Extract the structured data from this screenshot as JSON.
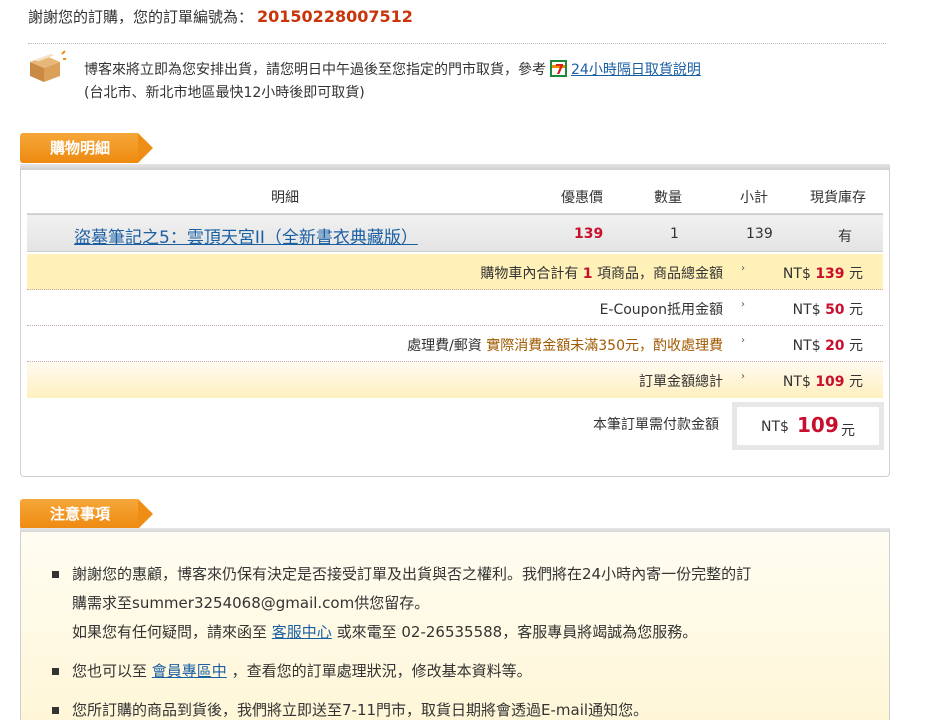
{
  "header": {
    "thanks": "謝謝您的訂購，您的訂單編號為：",
    "order_number": "20150228007512"
  },
  "shipping": {
    "line1": "博客來將立即為您安排出貨，請您明日中午過後至您指定的門市取貨，參考",
    "link": "24小時隔日取貨說明",
    "line2": "(台北市、新北市地區最快12小時後即可取貨)"
  },
  "section_detail": {
    "title": "購物明細"
  },
  "table": {
    "headers": [
      "明細",
      "優惠價",
      "數量",
      "小計",
      "現貨庫存"
    ],
    "item": {
      "name": "盜墓筆記之5：雲頂天宮II（全新書衣典藏版）",
      "price": "139",
      "qty": "1",
      "subtotal": "139",
      "stock": "有"
    }
  },
  "summary": {
    "cart_pre": "購物車內合計有",
    "cart_count": "1",
    "cart_post": "項商品，商品總金額",
    "cart_amount": "139",
    "coupon_label": "E-Coupon抵用金額",
    "coupon_amount": "50",
    "fee_label": "處理費/郵資",
    "fee_note": "實際消費金額未滿350元，酌收處理費",
    "fee_amount": "20",
    "total_label": "訂單金額總計",
    "total_amount": "109",
    "currency": "NT$",
    "unit": "元",
    "arrow": "›",
    "pay_label": "本筆訂單需付款金額",
    "pay_amount": "109"
  },
  "section_notes": {
    "title": "注意事項"
  },
  "notes": {
    "n1_line1": "謝謝您的惠顧，博客來仍保有決定是否接受訂單及出貨與否之權利。我們將在24小時內寄一份完整的訂",
    "n1_line2": "購需求至summer3254068@gmail.com供您留存。",
    "n1_line3_pre": "如果您有任何疑問，請來函至",
    "n1_link": "客服中心",
    "n1_line3_post": "或來電至 02-26535588，客服專員將竭誠為您服務。",
    "n2_pre": "您也可以至",
    "n2_link": "會員專區中",
    "n2_post": "，查看您的訂單處理狀況，修改基本資料等。",
    "n3": "您所訂購的商品到貨後，我們將立即送至7-11門市，取貨日期將會透過E-mail通知您。"
  }
}
